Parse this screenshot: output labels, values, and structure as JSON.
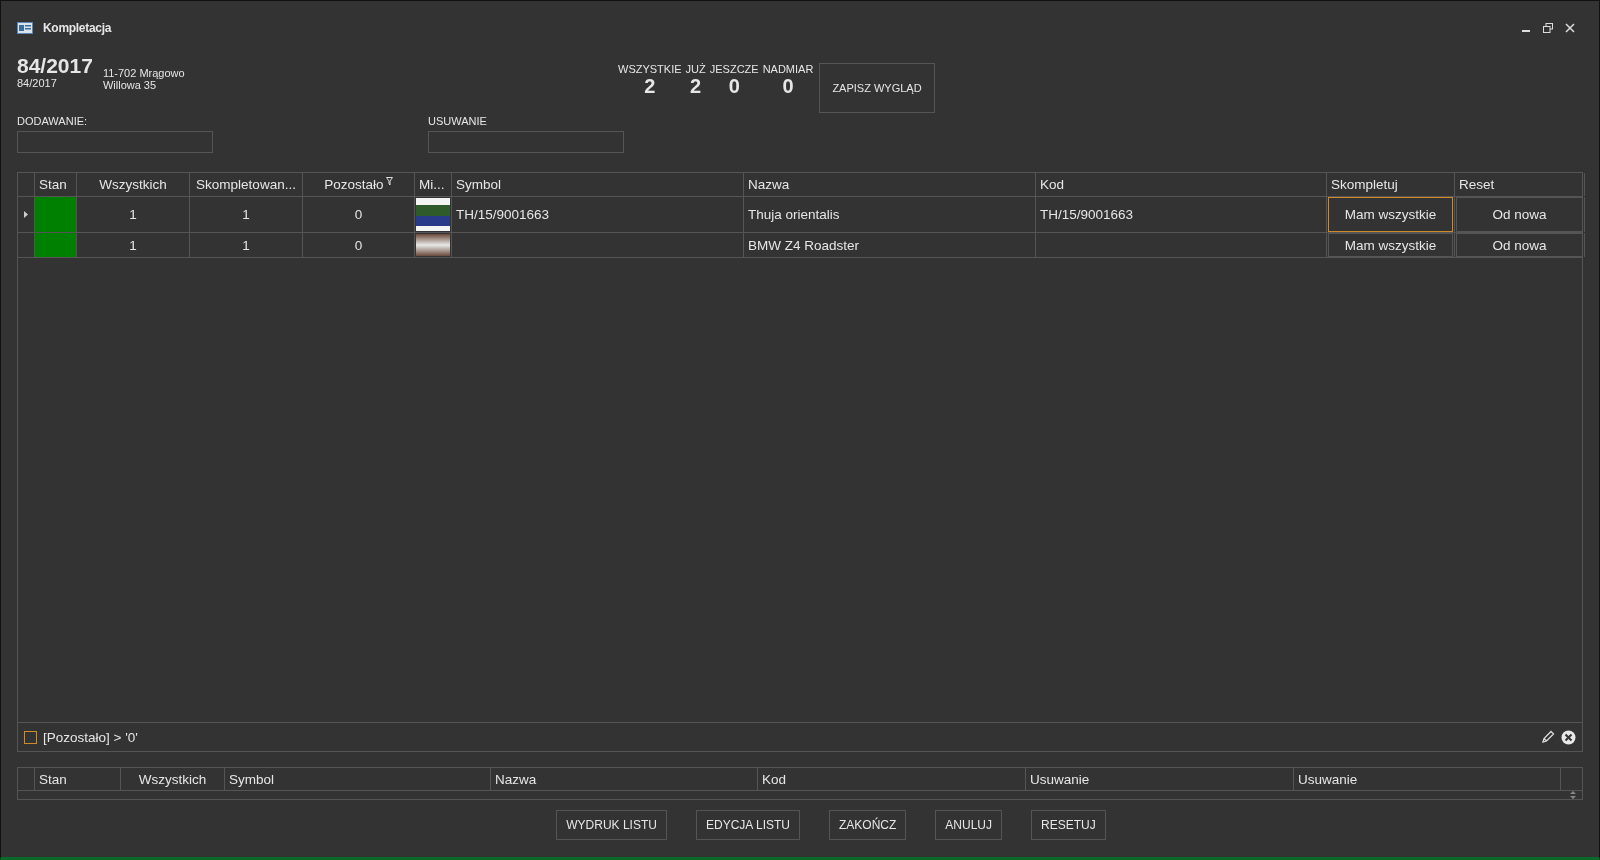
{
  "window": {
    "title": "Kompletacja"
  },
  "document": {
    "number": "84/2017",
    "subnumber": "84/2017",
    "address_line_1": "11-702 Mrągowo",
    "address_line_2": "Willowa 35"
  },
  "counters": [
    {
      "label": "WSZYSTKIE",
      "value": "2"
    },
    {
      "label": "JUŻ",
      "value": "2"
    },
    {
      "label": "JESZCZE",
      "value": "0"
    },
    {
      "label": "NADMIAR",
      "value": "0"
    }
  ],
  "save_layout_button": "ZAPISZ WYGLĄD",
  "fields": [
    {
      "label": "DODAWANIE:"
    },
    {
      "label": "USUWANIE"
    }
  ],
  "table": {
    "columns": [
      "Stan",
      "Wszystkich",
      "Skompletowan...",
      "Pozostało",
      "Mi...",
      "Symbol",
      "Nazwa",
      "Kod",
      "Skompletuj",
      "Reset"
    ],
    "rows": [
      {
        "selected": true,
        "color": "#008000",
        "wszystkich": "1",
        "skompletowane": "1",
        "pozostalo": "0",
        "symbol": "TH/15/9001663",
        "nazwa": "Thuja orientalis",
        "kod": "TH/15/9001663",
        "complete_button": {
          "label": "Mam wszystkie",
          "focused": true
        },
        "reset_button": "Od nowa"
      },
      {
        "selected": false,
        "color": "#008000",
        "wszystkich": "1",
        "skompletowane": "1",
        "pozostalo": "0",
        "symbol": "",
        "nazwa": "BMW Z4 Roadster",
        "kod": "",
        "complete_button": {
          "label": "Mam wszystkie",
          "focused": false
        },
        "reset_button": "Od nowa"
      }
    ]
  },
  "filter": {
    "checked": false,
    "text": "[Pozostało] > '0'"
  },
  "removed_table": {
    "columns": [
      "Stan",
      "Wszystkich",
      "Symbol",
      "Nazwa",
      "Kod",
      "Usuwanie",
      "Usuwanie"
    ]
  },
  "buttons": [
    "WYDRUK LISTU",
    "EDYCJA LISTU",
    "ZAKOŃCZ",
    "ANULUJ",
    "RESETUJ"
  ]
}
